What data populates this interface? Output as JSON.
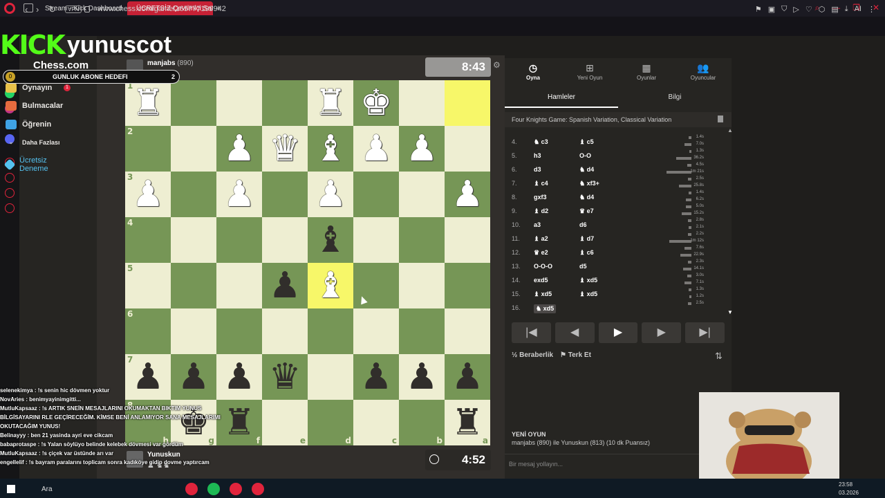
{
  "browser": {
    "tabs": [
      {
        "label": "Stream - Kick Dashboard"
      },
      {
        "label": "ÜCRETSİZ Çevrimiçi Satranç"
      }
    ],
    "new_tab": "+",
    "url": "www.chess.com/game/165777199942",
    "vpn_label": "VPN",
    "toolbar_extra": "AI"
  },
  "overlay": {
    "kick_logo": "KICK",
    "streamer": "yunuscot",
    "sub_goal_label": "GUNLUK ABONE HEDEFI",
    "sub_goal_current": "0",
    "sub_goal_target": "2"
  },
  "sidebar": {
    "logo": "Chess.com",
    "items": [
      {
        "label": "Oynayın",
        "color": "#e8c14a"
      },
      {
        "label": "Bulmacalar",
        "color": "#e56b3f"
      },
      {
        "label": "Öğrenin",
        "color": "#3fa2e5"
      },
      {
        "label": "Daha Fazlası",
        "color": "#262522"
      },
      {
        "label": "Ücretsiz Deneme",
        "color": "#55c2f0"
      }
    ],
    "badge": "1"
  },
  "players": {
    "opponent_name": "manjabs",
    "opponent_rating": "(890)",
    "opponent_clock": "8:43",
    "me_name": "Yunuskun",
    "my_clock": "4:52"
  },
  "board": {
    "rank_labels": [
      "1",
      "2",
      "3",
      "4",
      "5",
      "6",
      "7",
      "8"
    ],
    "file_labels": [
      "h",
      "g",
      "f",
      "e",
      "d",
      "c",
      "b",
      "a"
    ],
    "rows": [
      [
        "♜",
        "",
        "",
        "",
        "♜",
        "♚",
        "",
        ""
      ],
      [
        "",
        "",
        "♟",
        "♛",
        "♝",
        "♟",
        "♟",
        ""
      ],
      [
        "♟",
        "",
        "♟",
        "",
        "♟",
        "",
        "",
        "♟"
      ],
      [
        "",
        "",
        "",
        "",
        "♝",
        "",
        "",
        ""
      ],
      [
        "",
        "",
        "",
        "♟",
        "♝",
        "",
        "",
        ""
      ],
      [
        "",
        "",
        "",
        "",
        "",
        "",
        "",
        ""
      ],
      [
        "♟",
        "♟",
        "♟",
        "♛",
        "",
        "♟",
        "♟",
        "♟"
      ],
      [
        "",
        "♚",
        "♜",
        "",
        "",
        "",
        "",
        "♜"
      ]
    ],
    "colors": [
      [
        "w",
        "",
        "",
        "",
        "w",
        "w",
        "",
        ""
      ],
      [
        "",
        "",
        "w",
        "w",
        "w",
        "w",
        "w",
        ""
      ],
      [
        "w",
        "",
        "w",
        "",
        "w",
        "",
        "",
        "w"
      ],
      [
        "",
        "",
        "",
        "",
        "b",
        "",
        "",
        ""
      ],
      [
        "",
        "",
        "",
        "b",
        "w",
        "",
        "",
        ""
      ],
      [
        "",
        "",
        "",
        "",
        "",
        "",
        "",
        ""
      ],
      [
        "b",
        "b",
        "b",
        "b",
        "",
        "b",
        "b",
        "b"
      ],
      [
        "",
        "b",
        "b",
        "",
        "",
        "",
        "",
        "b"
      ]
    ],
    "highlights": [
      "0-7",
      "4-4"
    ]
  },
  "panel": {
    "tabs": [
      {
        "label": "Oyna",
        "glyph": "◷"
      },
      {
        "label": "Yeni Oyun",
        "glyph": "⊞"
      },
      {
        "label": "Oyunlar",
        "glyph": "▦"
      },
      {
        "label": "Oyuncular",
        "glyph": "👥"
      }
    ],
    "subtabs": [
      "Hamleler",
      "Bilgi"
    ],
    "opening": "Four Knights Game: Spanish Variation, Classical Variation",
    "moves": [
      {
        "n": "4.",
        "w": "♞ c3",
        "b": "♝ c5",
        "t1": "1.4s",
        "t2": "7.0s",
        "b1": 4,
        "b2": 10
      },
      {
        "n": "5.",
        "w": "h3",
        "b": "O-O",
        "t1": "1.3s",
        "t2": "36.2s",
        "b1": 3,
        "b2": 22
      },
      {
        "n": "6.",
        "w": "d3",
        "b": "♞ d4",
        "t1": "4.5s",
        "t2": "1m 21s",
        "b1": 6,
        "b2": 36
      },
      {
        "n": "7.",
        "w": "♝ c4",
        "b": "♞ xf3+",
        "t1": "2.5s",
        "t2": "25.8s",
        "b1": 5,
        "b2": 18
      },
      {
        "n": "8.",
        "w": "gxf3",
        "b": "♞ d4",
        "t1": "1.4s",
        "t2": "6.2s",
        "b1": 4,
        "b2": 8
      },
      {
        "n": "9.",
        "w": "♝ d2",
        "b": "♛ e7",
        "t1": "5.0s",
        "t2": "15.2s",
        "b1": 8,
        "b2": 14
      },
      {
        "n": "10.",
        "w": "a3",
        "b": "d6",
        "t1": "2.8s",
        "t2": "2.1s",
        "b1": 5,
        "b2": 4
      },
      {
        "n": "11.",
        "w": "♝ a2",
        "b": "♝ d7",
        "t1": "2.2s",
        "t2": "1m 12s",
        "b1": 5,
        "b2": 32
      },
      {
        "n": "12.",
        "w": "♛ e2",
        "b": "♝ c6",
        "t1": "7.6s",
        "t2": "22.9s",
        "b1": 10,
        "b2": 16
      },
      {
        "n": "13.",
        "w": "O-O-O",
        "b": "d5",
        "t1": "2.3s",
        "t2": "14.1s",
        "b1": 5,
        "b2": 12
      },
      {
        "n": "14.",
        "w": "exd5",
        "b": "♝ xd5",
        "t1": "3.0s",
        "t2": "7.1s",
        "b1": 6,
        "b2": 10
      },
      {
        "n": "15.",
        "w": "♝ xd5",
        "b": "♝ xd5",
        "t1": "1.3s",
        "t2": "1.2s",
        "b1": 4,
        "b2": 3
      },
      {
        "n": "16.",
        "w": "♞ xd5",
        "b": "",
        "t1": "2.5s",
        "t2": "",
        "b1": 5,
        "b2": 0
      }
    ],
    "controls": [
      "|◀",
      "◀",
      "▶",
      "▶",
      "▶|"
    ],
    "draw_label": "Beraberlik",
    "resign_label": "Terk Et",
    "new_game_title": "YENİ OYUN",
    "new_game_desc": "manjabs (890) ile Yunuskun (813) (10 dk Puansız)",
    "chat_placeholder": "Bir mesaj yollayın..."
  },
  "chat": [
    "selenekimya : !s senin hic dövmen yoktur",
    "NovAries : benimyayinimgitti...",
    "MutluKapsaaz : !s ARTIK SNEİN MESAJLARINI OKUMAKTAN BIKTIM YUNUS",
    "BİLGİSAYARINI RLE GEÇİRECEĞİM. KİMSE BENİ ANLAMIYOR SANA MESAJLARIMI",
    "OKUTACAĞIM YUNUS!",
    "Belinayyy : ben 21 yasinda ayri eve cikcam",
    "babaprotaspe : !s Yalan söylüyo belinde kelebek dövmesi var gördüm",
    "MutluKapsaaz : !s çiçek var üstünde arı var",
    "engellelif : !s bayram paralarını toplicam sonra kadıköye gidip dovme yaptırcam"
  ],
  "taskbar": {
    "search": "Ara",
    "apps": [
      "#e0243c",
      "#1db954",
      "#e0243c",
      "#e0243c"
    ],
    "time": "23:58",
    "date": "03.2026"
  }
}
